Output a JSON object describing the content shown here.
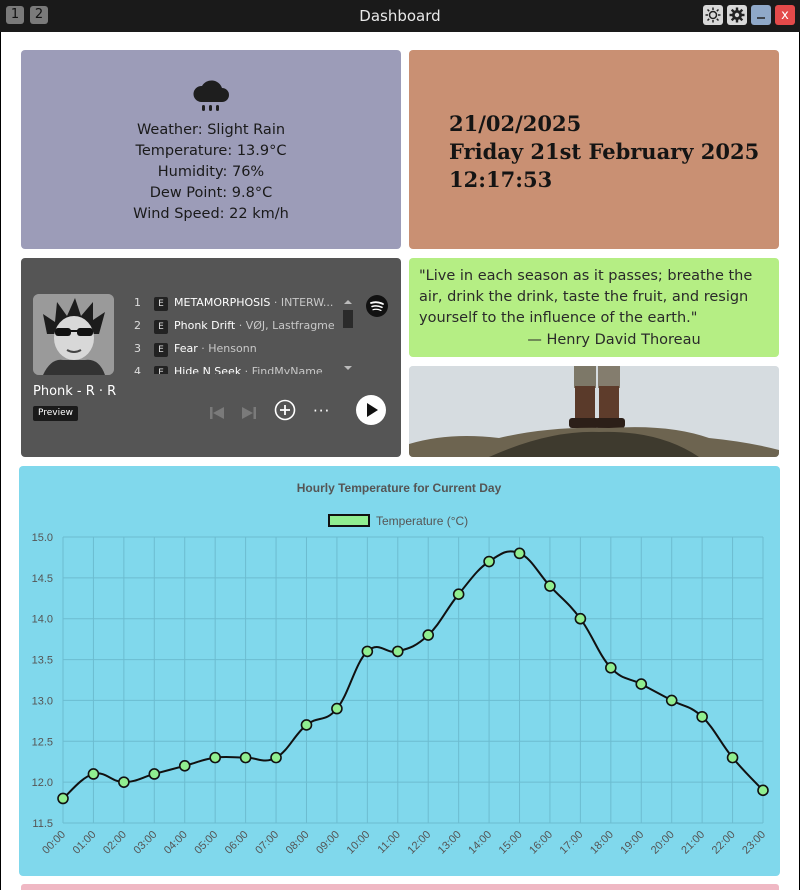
{
  "titlebar": {
    "title": "Dashboard",
    "workspaces": [
      "1",
      "2"
    ],
    "close_label": "x"
  },
  "weather": {
    "icon": "rain-cloud-icon",
    "lines": [
      "Weather: Slight Rain",
      "Temperature: 13.9°C",
      "Humidity: 76%",
      "Dew Point: 9.8°C",
      "Wind Speed: 22 km/h"
    ]
  },
  "datetime": {
    "date_numeric": "21/02/2025",
    "date_long": "Friday 21st February 2025",
    "time": "12:17:53"
  },
  "spotify": {
    "playlist_name": "Phonk - R · R",
    "preview_label": "Preview",
    "tracks": [
      {
        "num": "1",
        "badge": "E",
        "title": "METAMORPHOSIS",
        "artist": "INTERW..."
      },
      {
        "num": "2",
        "badge": "E",
        "title": "Phonk Drift",
        "artist": "VØJ, Lastfragme..."
      },
      {
        "num": "3",
        "badge": "E",
        "title": "Fear",
        "artist": "Hensonn"
      },
      {
        "num": "4",
        "badge": "E",
        "title": "Hide N Seek",
        "artist": "FindMyName"
      }
    ],
    "more_label": "···"
  },
  "quote": {
    "text": "\"Live in each season as it passes; breathe the air, drink the drink, taste the fruit, and resign yourself to the influence of the earth.\"",
    "author": "— Henry David Thoreau"
  },
  "colors": {
    "weather_bg": "#9c9cb8",
    "date_bg": "#c99073",
    "spotify_bg": "#555555",
    "quote_bg": "#b5ee84",
    "chart_bg": "#80d8ec",
    "point_fill": "#90ee90"
  },
  "chart_data": {
    "type": "line",
    "title": "Hourly Temperature for Current Day",
    "legend_position": "top",
    "series": [
      {
        "name": "Temperature (°C)",
        "values": [
          11.8,
          12.1,
          12.0,
          12.1,
          12.2,
          12.3,
          12.3,
          12.3,
          12.7,
          12.9,
          13.6,
          13.6,
          13.8,
          14.3,
          14.7,
          14.8,
          14.4,
          14.0,
          13.4,
          13.2,
          13.0,
          12.8,
          12.3,
          11.9
        ]
      }
    ],
    "categories": [
      "00:00",
      "01:00",
      "02:00",
      "03:00",
      "04:00",
      "05:00",
      "06:00",
      "07:00",
      "08:00",
      "09:00",
      "10:00",
      "11:00",
      "12:00",
      "13:00",
      "14:00",
      "15:00",
      "16:00",
      "17:00",
      "18:00",
      "19:00",
      "20:00",
      "21:00",
      "22:00",
      "23:00"
    ],
    "ylim": [
      11.5,
      15.0
    ],
    "yticks": [
      "15.0",
      "14.5",
      "14.0",
      "13.5",
      "13.0",
      "12.5",
      "12.0",
      "11.5"
    ],
    "grid": true
  }
}
